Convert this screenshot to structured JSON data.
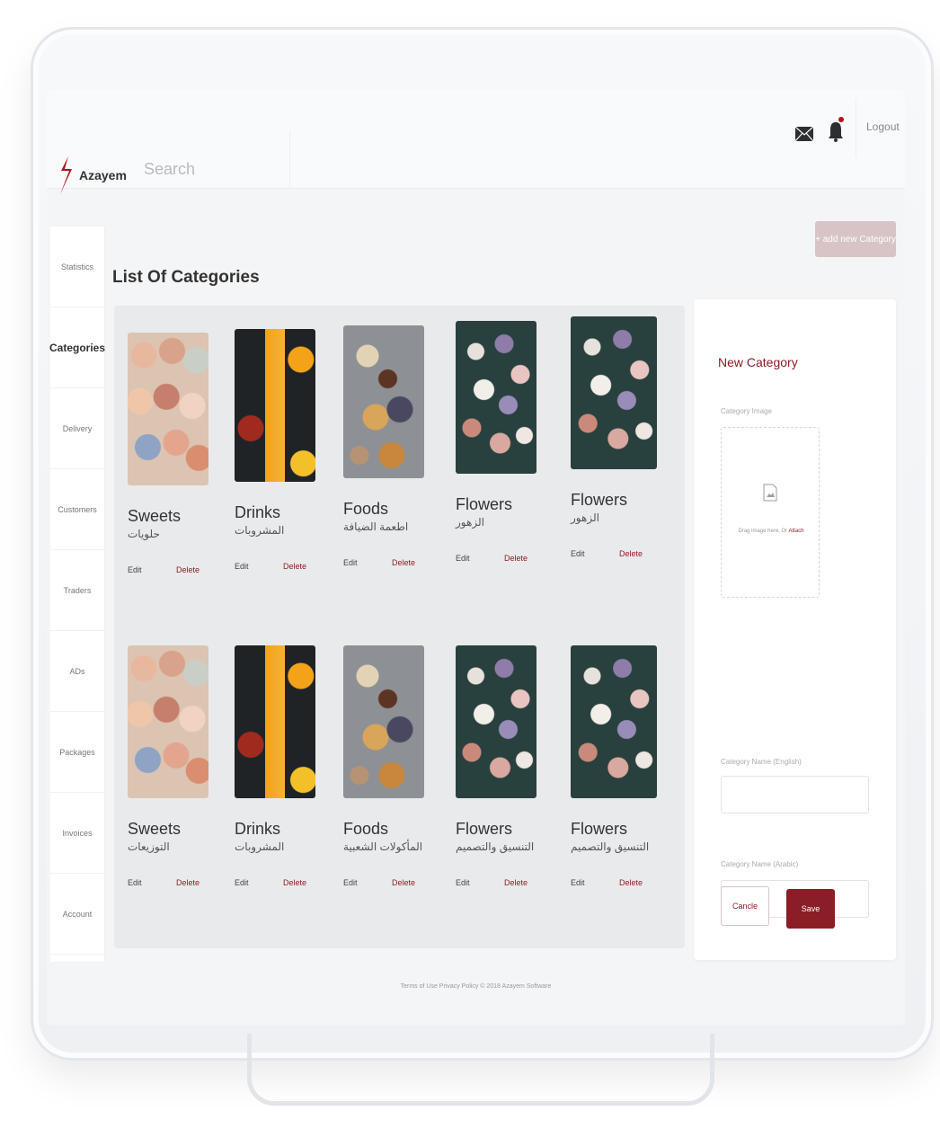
{
  "brand": {
    "name": "Azayem",
    "accent": "#8a1d25"
  },
  "header": {
    "search_placeholder": "Search",
    "logout": "Logout"
  },
  "sidebar": {
    "items": [
      {
        "label": "Statistics"
      },
      {
        "label": "Categories",
        "active": true
      },
      {
        "label": "Delivery"
      },
      {
        "label": "Customers"
      },
      {
        "label": "Traders"
      },
      {
        "label": "ADs"
      },
      {
        "label": "Packages"
      },
      {
        "label": "Invoices"
      },
      {
        "label": "Account"
      }
    ]
  },
  "main": {
    "title": "List Of Categories",
    "add_button": "+ add new Category",
    "cards": [
      {
        "en": "Sweets",
        "ar": "حلويات",
        "image": "sweets",
        "edit": "Edit",
        "delete": "Delete"
      },
      {
        "en": "Drinks",
        "ar": "المشروبات",
        "image": "drinks",
        "edit": "Edit",
        "delete": "Delete"
      },
      {
        "en": "Foods",
        "ar": "اطعمة الضيافة",
        "image": "foods",
        "edit": "Edit",
        "delete": "Delete"
      },
      {
        "en": "Flowers",
        "ar": "الزهور",
        "image": "flowers",
        "edit": "Edit",
        "delete": "Delete"
      },
      {
        "en": "Flowers",
        "ar": "الزهور",
        "image": "flowers",
        "edit": "Edit",
        "delete": "Delete"
      },
      {
        "en": "Sweets",
        "ar": "التوزيعات",
        "image": "sweets",
        "edit": "Edit",
        "delete": "Delete"
      },
      {
        "en": "Drinks",
        "ar": "المشروبات",
        "image": "drinks",
        "edit": "Edit",
        "delete": "Delete"
      },
      {
        "en": "Foods",
        "ar": "المأكولات الشعبية",
        "image": "foods",
        "edit": "Edit",
        "delete": "Delete"
      },
      {
        "en": "Flowers",
        "ar": "التنسيق والتصميم",
        "image": "flowers",
        "edit": "Edit",
        "delete": "Delete"
      },
      {
        "en": "Flowers",
        "ar": "التنسيق والتصميم",
        "image": "flowers",
        "edit": "Edit",
        "delete": "Delete"
      }
    ]
  },
  "panel": {
    "title": "New Category",
    "image_label": "Category Image",
    "drop_text": "Drag image here, Or",
    "drop_link": "Attach",
    "name_en_label": "Category Name (English)",
    "name_ar_label": "Category Name (Arabic)",
    "name_en_value": "",
    "name_ar_value": "",
    "cancel": "Cancle",
    "save": "Save"
  },
  "footer": {
    "text": "Terms of Use   Privacy Policy   © 2018 Azayem Software"
  }
}
